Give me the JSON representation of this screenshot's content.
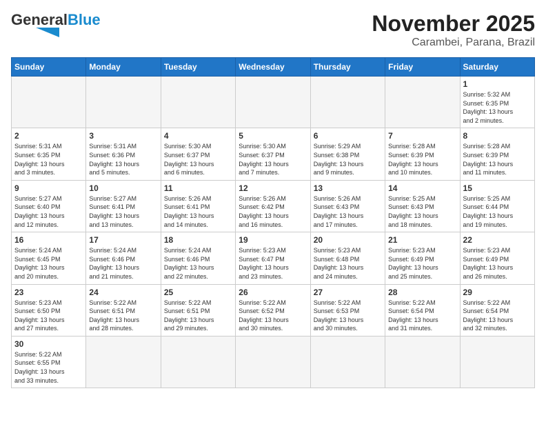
{
  "logo": {
    "text_general": "General",
    "text_blue": "Blue"
  },
  "title": "November 2025",
  "subtitle": "Carambei, Parana, Brazil",
  "weekdays": [
    "Sunday",
    "Monday",
    "Tuesday",
    "Wednesday",
    "Thursday",
    "Friday",
    "Saturday"
  ],
  "weeks": [
    [
      {
        "day": "",
        "info": ""
      },
      {
        "day": "",
        "info": ""
      },
      {
        "day": "",
        "info": ""
      },
      {
        "day": "",
        "info": ""
      },
      {
        "day": "",
        "info": ""
      },
      {
        "day": "",
        "info": ""
      },
      {
        "day": "1",
        "info": "Sunrise: 5:32 AM\nSunset: 6:35 PM\nDaylight: 13 hours\nand 2 minutes."
      }
    ],
    [
      {
        "day": "2",
        "info": "Sunrise: 5:31 AM\nSunset: 6:35 PM\nDaylight: 13 hours\nand 3 minutes."
      },
      {
        "day": "3",
        "info": "Sunrise: 5:31 AM\nSunset: 6:36 PM\nDaylight: 13 hours\nand 5 minutes."
      },
      {
        "day": "4",
        "info": "Sunrise: 5:30 AM\nSunset: 6:37 PM\nDaylight: 13 hours\nand 6 minutes."
      },
      {
        "day": "5",
        "info": "Sunrise: 5:30 AM\nSunset: 6:37 PM\nDaylight: 13 hours\nand 7 minutes."
      },
      {
        "day": "6",
        "info": "Sunrise: 5:29 AM\nSunset: 6:38 PM\nDaylight: 13 hours\nand 9 minutes."
      },
      {
        "day": "7",
        "info": "Sunrise: 5:28 AM\nSunset: 6:39 PM\nDaylight: 13 hours\nand 10 minutes."
      },
      {
        "day": "8",
        "info": "Sunrise: 5:28 AM\nSunset: 6:39 PM\nDaylight: 13 hours\nand 11 minutes."
      }
    ],
    [
      {
        "day": "9",
        "info": "Sunrise: 5:27 AM\nSunset: 6:40 PM\nDaylight: 13 hours\nand 12 minutes."
      },
      {
        "day": "10",
        "info": "Sunrise: 5:27 AM\nSunset: 6:41 PM\nDaylight: 13 hours\nand 13 minutes."
      },
      {
        "day": "11",
        "info": "Sunrise: 5:26 AM\nSunset: 6:41 PM\nDaylight: 13 hours\nand 14 minutes."
      },
      {
        "day": "12",
        "info": "Sunrise: 5:26 AM\nSunset: 6:42 PM\nDaylight: 13 hours\nand 16 minutes."
      },
      {
        "day": "13",
        "info": "Sunrise: 5:26 AM\nSunset: 6:43 PM\nDaylight: 13 hours\nand 17 minutes."
      },
      {
        "day": "14",
        "info": "Sunrise: 5:25 AM\nSunset: 6:43 PM\nDaylight: 13 hours\nand 18 minutes."
      },
      {
        "day": "15",
        "info": "Sunrise: 5:25 AM\nSunset: 6:44 PM\nDaylight: 13 hours\nand 19 minutes."
      }
    ],
    [
      {
        "day": "16",
        "info": "Sunrise: 5:24 AM\nSunset: 6:45 PM\nDaylight: 13 hours\nand 20 minutes."
      },
      {
        "day": "17",
        "info": "Sunrise: 5:24 AM\nSunset: 6:46 PM\nDaylight: 13 hours\nand 21 minutes."
      },
      {
        "day": "18",
        "info": "Sunrise: 5:24 AM\nSunset: 6:46 PM\nDaylight: 13 hours\nand 22 minutes."
      },
      {
        "day": "19",
        "info": "Sunrise: 5:23 AM\nSunset: 6:47 PM\nDaylight: 13 hours\nand 23 minutes."
      },
      {
        "day": "20",
        "info": "Sunrise: 5:23 AM\nSunset: 6:48 PM\nDaylight: 13 hours\nand 24 minutes."
      },
      {
        "day": "21",
        "info": "Sunrise: 5:23 AM\nSunset: 6:49 PM\nDaylight: 13 hours\nand 25 minutes."
      },
      {
        "day": "22",
        "info": "Sunrise: 5:23 AM\nSunset: 6:49 PM\nDaylight: 13 hours\nand 26 minutes."
      }
    ],
    [
      {
        "day": "23",
        "info": "Sunrise: 5:23 AM\nSunset: 6:50 PM\nDaylight: 13 hours\nand 27 minutes."
      },
      {
        "day": "24",
        "info": "Sunrise: 5:22 AM\nSunset: 6:51 PM\nDaylight: 13 hours\nand 28 minutes."
      },
      {
        "day": "25",
        "info": "Sunrise: 5:22 AM\nSunset: 6:51 PM\nDaylight: 13 hours\nand 29 minutes."
      },
      {
        "day": "26",
        "info": "Sunrise: 5:22 AM\nSunset: 6:52 PM\nDaylight: 13 hours\nand 30 minutes."
      },
      {
        "day": "27",
        "info": "Sunrise: 5:22 AM\nSunset: 6:53 PM\nDaylight: 13 hours\nand 30 minutes."
      },
      {
        "day": "28",
        "info": "Sunrise: 5:22 AM\nSunset: 6:54 PM\nDaylight: 13 hours\nand 31 minutes."
      },
      {
        "day": "29",
        "info": "Sunrise: 5:22 AM\nSunset: 6:54 PM\nDaylight: 13 hours\nand 32 minutes."
      }
    ],
    [
      {
        "day": "30",
        "info": "Sunrise: 5:22 AM\nSunset: 6:55 PM\nDaylight: 13 hours\nand 33 minutes."
      },
      {
        "day": "",
        "info": ""
      },
      {
        "day": "",
        "info": ""
      },
      {
        "day": "",
        "info": ""
      },
      {
        "day": "",
        "info": ""
      },
      {
        "day": "",
        "info": ""
      },
      {
        "day": "",
        "info": ""
      }
    ]
  ]
}
